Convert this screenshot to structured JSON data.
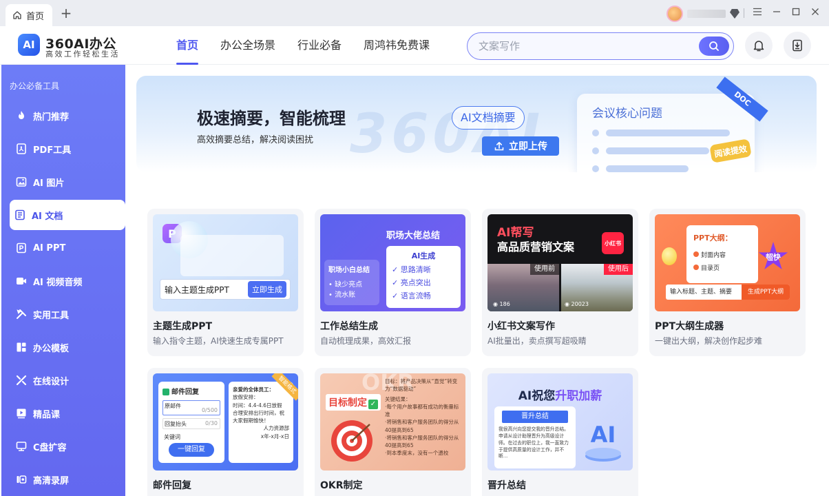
{
  "titlebar": {
    "tab_label": "首页",
    "new_tab": "+"
  },
  "header": {
    "logo_badge": "AI",
    "logo_title": "360AI办公",
    "logo_subtitle": "高效工作轻松生活",
    "nav": [
      "首页",
      "办公全场景",
      "行业必备",
      "周鸿祎免费课"
    ],
    "search_placeholder": "文案写作"
  },
  "sidebar": {
    "section_title": "办公必备工具",
    "items": [
      {
        "label": "热门推荐",
        "icon": "flame-icon"
      },
      {
        "label": "PDF工具",
        "icon": "pdf-icon"
      },
      {
        "label": "AI 图片",
        "icon": "image-icon"
      },
      {
        "label": "AI 文档",
        "icon": "document-icon",
        "active": true
      },
      {
        "label": "AI PPT",
        "icon": "ppt-icon"
      },
      {
        "label": "AI 视频音频",
        "icon": "video-icon"
      },
      {
        "label": "实用工具",
        "icon": "tools-icon"
      },
      {
        "label": "办公模板",
        "icon": "template-icon"
      },
      {
        "label": "在线设计",
        "icon": "design-icon"
      },
      {
        "label": "精品课",
        "icon": "course-icon"
      },
      {
        "label": "C盘扩容",
        "icon": "disk-icon"
      },
      {
        "label": "高清录屏",
        "icon": "record-icon"
      }
    ]
  },
  "banner": {
    "title": "极速摘要，智能梳理",
    "subtitle": "高效摘要总结，解决阅读困扰",
    "pill": "AI文档摘要",
    "upload": "立即上传",
    "watermark": "360AI",
    "doc_title": "会议核心问题",
    "doc_tag": "阅读提效",
    "doc_ribbon": "DOC"
  },
  "cards": [
    {
      "title": "主题生成PPT",
      "desc": "输入指令主题，AI快速生成专属PPT",
      "thumb": {
        "input": "输入主题生成PPT",
        "button": "立即生成",
        "badge": "P"
      }
    },
    {
      "title": "工作总结生成",
      "desc": "自动梳理成果，高效汇报",
      "thumb": {
        "headline": "职场大佬总结",
        "left_title": "职场小白总结",
        "left_points": [
          "• 缺少亮点",
          "• 流水账"
        ],
        "right_title": "AI生成",
        "right_points": [
          "✓ 思路清晰",
          "✓ 亮点突出",
          "✓ 语言流畅"
        ]
      }
    },
    {
      "title": "小红书文案写作",
      "desc": "AI批量出，卖点撰写超吸睛",
      "thumb": {
        "line1": "AI帮写",
        "line2": "高品质营销文案",
        "logo": "小红书",
        "before": "使用前",
        "after": "使用后",
        "count1": "186",
        "count2": "20023"
      }
    },
    {
      "title": "PPT大纲生成器",
      "desc": "一键出大纲，解决创作起步难",
      "thumb": {
        "heading": "PPT大纲：",
        "item1": "封面内容",
        "item2": "目录页",
        "badge": "超快",
        "input": "输入标题、主题、摘要",
        "button": "生成PPT大纲"
      }
    },
    {
      "title": "邮件回复",
      "desc": "",
      "thumb": {
        "panel_title": "邮件回复",
        "field1": "原邮件",
        "field1_count": "0/500",
        "field2": "回复抬头",
        "field2_count": "0/30",
        "field3": "关键词",
        "button": "一键回复",
        "letter_title": "亲爱的全体员工：",
        "letter_lines": [
          "放假安排：",
          "时间：4.4-4.6日放假",
          "合理安排出行时间，祝大家假期愉快！"
        ],
        "letter_sign": "人力资源部",
        "letter_date": "x年-x月-x日",
        "ribbon": "智能格式"
      }
    },
    {
      "title": "OKR制定",
      "desc": "",
      "thumb": {
        "tag": "目标制定",
        "watermark": "OKR",
        "goal": "目标：将产品决策从“直觉”转变为“数据驱动”",
        "kr_title": "关键结果：",
        "kr_lines": [
          "·每个用户故事都有成功的衡量标准",
          "·将销售和客户服务团队的得分从40提高到65",
          "·将销售和客户服务团队的得分从40提高到65",
          "·到本季度末，没有一个遗校"
        ]
      }
    },
    {
      "title": "晋升总结",
      "desc": "",
      "thumb": {
        "headline_a": "AI祝您",
        "headline_b": "升职加薪",
        "doc_title": "晋升总结",
        "doc_text": "我很高兴向您提交我的晋升总结。申请从设计助理晋升为高级设计师。在过去的职位上，我一直致力于提供高质量的设计工作，并不断..."
      }
    }
  ],
  "colors": {
    "accent": "#4e57f0",
    "sidebar": "#6a74f4",
    "card_bg": "#f4f5f8"
  }
}
